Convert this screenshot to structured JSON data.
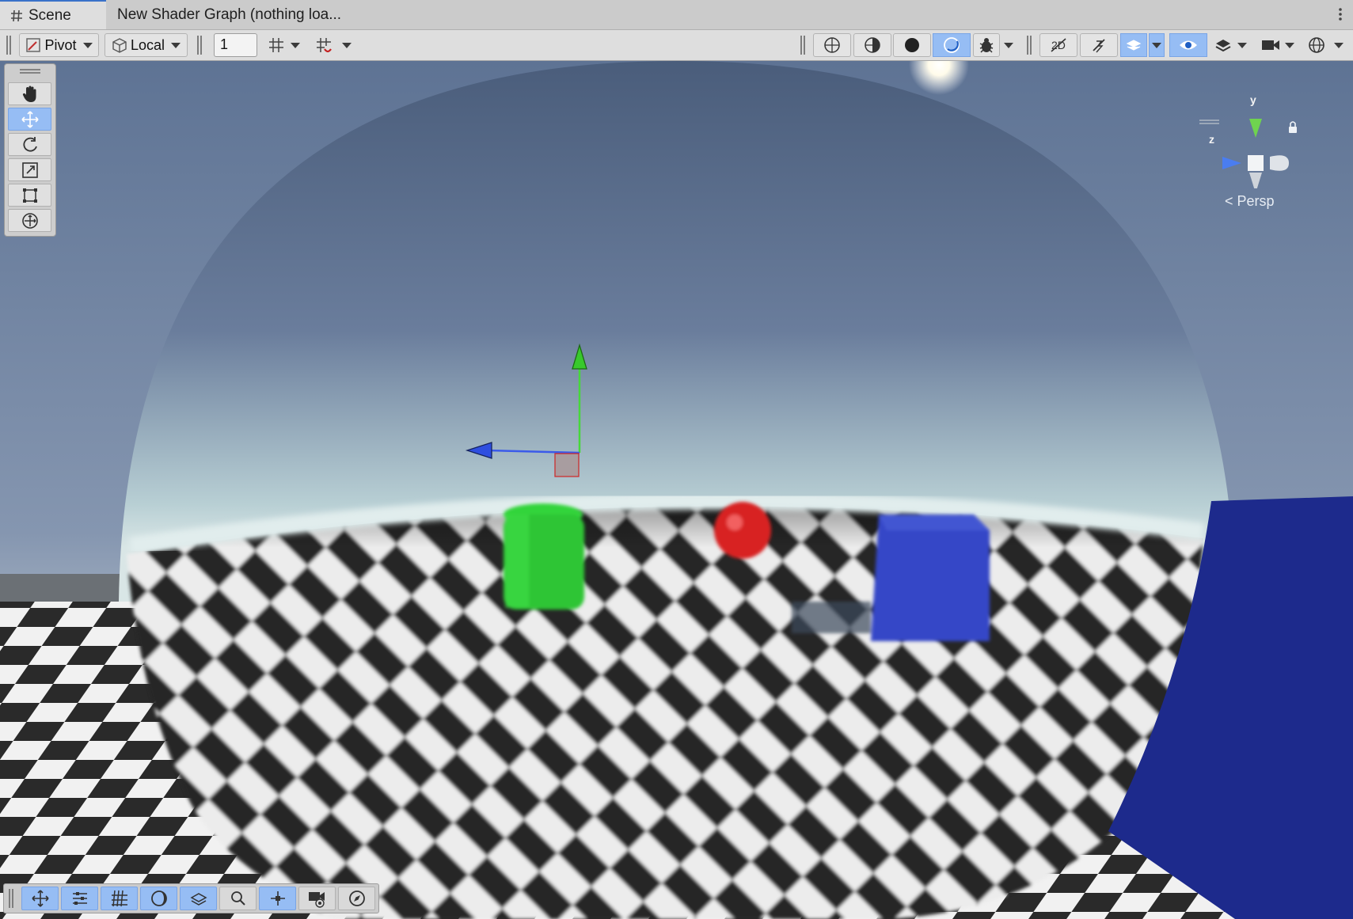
{
  "tabs": [
    {
      "label": "Scene",
      "icon": "grid-hash-icon",
      "active": true
    },
    {
      "label": "New Shader Graph (nothing loa...",
      "active": false
    }
  ],
  "toolbar": {
    "pivot_label": "Pivot",
    "local_label": "Local",
    "grid_snap_value": "1"
  },
  "tools": [
    "hand-tool",
    "move-tool",
    "rotate-tool",
    "scale-tool",
    "rect-tool",
    "transform-tool"
  ],
  "active_tool": "move-tool",
  "gizmo": {
    "y_label": "y",
    "z_label": "z",
    "projection_label": "Persp"
  },
  "overlay_tools": [
    "move",
    "settings",
    "grid",
    "lighting",
    "layers",
    "search",
    "pivot-handles",
    "camera",
    "navigation"
  ],
  "colors": {
    "accent": "#3a72c9",
    "active_button": "#96bdf4",
    "toolbar": "#dedede"
  }
}
